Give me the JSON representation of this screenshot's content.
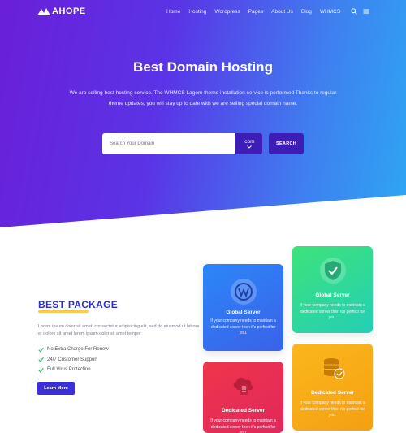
{
  "brand": {
    "logo_text": "AHOPE"
  },
  "nav": {
    "items": [
      "Home",
      "Hosting",
      "Wordpress",
      "Pages",
      "About Us",
      "Blog",
      "WHMCS"
    ],
    "icons": [
      "search-icon",
      "menu-icon"
    ]
  },
  "hero": {
    "title": "Best Domain Hosting",
    "subtitle": "We are selling best hosting service. The WHMCS Lagom theme installation service is performed Thanks to regular theme updates, you will stay up to date with we are selling special domain name.",
    "search_placeholder": "Search Your Domain",
    "tld_value": ".com",
    "search_button": "SEARCH"
  },
  "package": {
    "title": "BEST PACKAGE",
    "description": "Lorem ipsum dolor sit amet, consectetur adipisicing elit, sed do eiusmod ut labore et dolore sit amet lorem ipsum dolor sit amet tempor",
    "features": [
      "No Extra Charge For Renew",
      "24/7 Customer Support",
      "Full Virus Protection"
    ],
    "button": "Learn More"
  },
  "cards": [
    {
      "title": "Global Server",
      "text": "If your company needs to maintain a dedicated server then it's perfect for you.",
      "icon": "wordpress-icon",
      "color": "#2c86f8"
    },
    {
      "title": "Global Server",
      "text": "If your company needs to maintain a dedicated server then it's perfect for you.",
      "icon": "shield-check-icon",
      "color": "#3de37a"
    },
    {
      "title": "Dedicated Server",
      "text": "If your company needs to maintain a dedicated server then it's perfect for you.",
      "icon": "cloud-server-icon",
      "color": "#f0354b"
    },
    {
      "title": "Dedicated Server",
      "text": "If your company needs to maintain a dedicated server then it's perfect for you.",
      "icon": "database-check-icon",
      "color": "#fbb71c"
    }
  ],
  "colors": {
    "accent": "#3e1db6",
    "title_blue": "#2b2fd0",
    "underline": "#fbbd1e"
  }
}
